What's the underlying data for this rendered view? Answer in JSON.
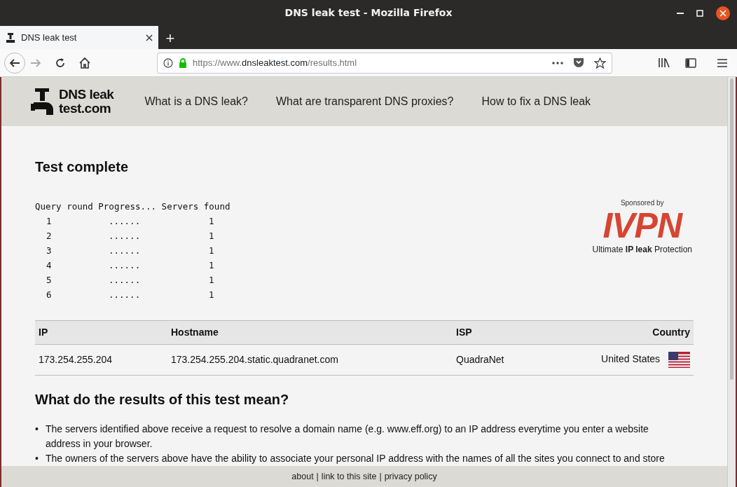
{
  "window": {
    "title": "DNS leak test - Mozilla Firefox"
  },
  "tabs": [
    {
      "label": "DNS leak test",
      "selected": true
    }
  ],
  "new_tab": "+",
  "address_bar": {
    "prefix": "https://www.",
    "domain": "dnsleaktest.com",
    "path": "/results.html"
  },
  "site_nav": {
    "logo_line_1": "DNS leak",
    "logo_line_2": "test.com",
    "links": [
      "What is a DNS leak?",
      "What are transparent DNS proxies?",
      "How to fix a DNS leak"
    ]
  },
  "heading": "Test complete",
  "query_table": {
    "header": "Query round Progress... Servers found",
    "rows": [
      {
        "round": "1",
        "progress": "......",
        "servers": "1"
      },
      {
        "round": "2",
        "progress": "......",
        "servers": "1"
      },
      {
        "round": "3",
        "progress": "......",
        "servers": "1"
      },
      {
        "round": "4",
        "progress": "......",
        "servers": "1"
      },
      {
        "round": "5",
        "progress": "......",
        "servers": "1"
      },
      {
        "round": "6",
        "progress": "......",
        "servers": "1"
      }
    ]
  },
  "sponsor": {
    "caption": "Sponsored by",
    "brand": "IVPN",
    "tagline_before": "Ultimate ",
    "tagline_bold": "IP leak",
    "tagline_after": " Protection"
  },
  "results_table": {
    "columns": [
      "IP",
      "Hostname",
      "ISP",
      "Country"
    ],
    "rows": [
      {
        "ip": "173.254.255.204",
        "hostname": "173.254.255.204.static.quadranet.com",
        "isp": "QuadraNet",
        "country": "United States"
      }
    ]
  },
  "section_heading": "What do the results of this test mean?",
  "bullet_marker": "•",
  "bullets": [
    "The servers identified above receive a request to resolve a domain name (e.g. www.eff.org) to an IP address everytime you enter a website address in your browser.",
    "The owners of the servers above have the ability to associate your personal IP address with the names of all the sites you connect to and store"
  ],
  "footer_links": [
    "about",
    "link to this site",
    "privacy policy"
  ],
  "footer_separators": [
    "|",
    "|"
  ]
}
